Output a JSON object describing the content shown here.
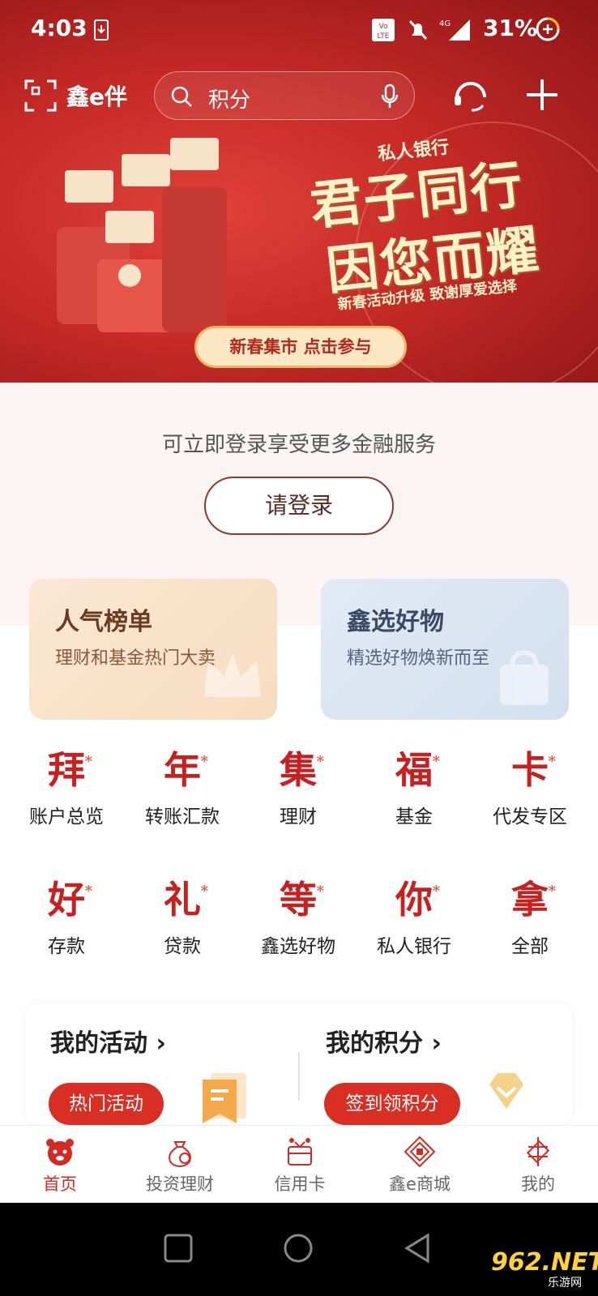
{
  "status_bar": {
    "time": "4:03",
    "network": "4G",
    "battery": "31%"
  },
  "header": {
    "brand": "鑫e伴",
    "search_placeholder": "积分"
  },
  "banner": {
    "brand": "私人银行",
    "headline_1": "君子同行",
    "headline_2": "因您而耀",
    "subline": "新春活动升级 致谢厚爱选择",
    "cta": "新春集市  点击参与"
  },
  "login": {
    "prompt": "可立即登录享受更多金融服务",
    "button": "请登录"
  },
  "cards": [
    {
      "title": "人气榜单",
      "subtitle": "理财和基金热门大卖"
    },
    {
      "title": "鑫选好物",
      "subtitle": "精选好物焕新而至"
    }
  ],
  "grid": [
    {
      "glyph": "拜",
      "label": "账户总览"
    },
    {
      "glyph": "年",
      "label": "转账汇款"
    },
    {
      "glyph": "集",
      "label": "理财"
    },
    {
      "glyph": "福",
      "label": "基金"
    },
    {
      "glyph": "卡",
      "label": "代发专区"
    },
    {
      "glyph": "好",
      "label": "存款"
    },
    {
      "glyph": "礼",
      "label": "贷款"
    },
    {
      "glyph": "等",
      "label": "鑫选好物"
    },
    {
      "glyph": "你",
      "label": "私人银行"
    },
    {
      "glyph": "拿",
      "label": "全部"
    }
  ],
  "activity": {
    "left_title": "我的活动 ›",
    "left_button": "热门活动",
    "right_title": "我的积分 ›",
    "right_button": "签到领积分"
  },
  "tabbar": [
    {
      "label": "首页",
      "icon": "tiger-icon",
      "active": true
    },
    {
      "label": "投资理财",
      "icon": "moneybag-icon",
      "active": false
    },
    {
      "label": "信用卡",
      "icon": "card-gift-icon",
      "active": false
    },
    {
      "label": "鑫e商城",
      "icon": "mall-icon",
      "active": false
    },
    {
      "label": "我的",
      "icon": "knot-icon",
      "active": false
    }
  ],
  "watermark": {
    "main": "962.NET",
    "sub": "乐游网"
  },
  "colors": {
    "primary": "#d32a22",
    "banner": "#c62a26",
    "gold": "#fbe7c3"
  }
}
